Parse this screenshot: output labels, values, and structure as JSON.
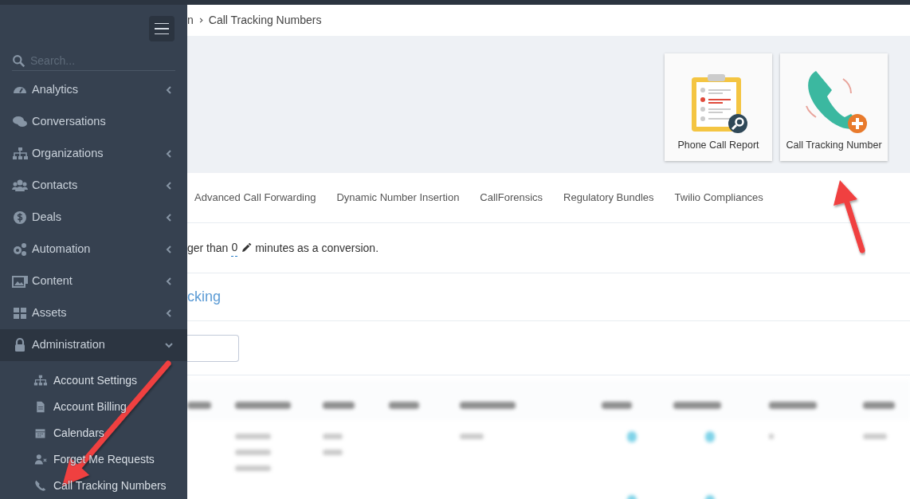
{
  "sidebar": {
    "search": {
      "placeholder": "Search..."
    },
    "items": [
      {
        "label": "Analytics",
        "kind": "group",
        "expanded": false,
        "selected": false
      },
      {
        "label": "Conversations",
        "kind": "link",
        "selected": false
      },
      {
        "label": "Organizations",
        "kind": "group",
        "expanded": false,
        "selected": false
      },
      {
        "label": "Contacts",
        "kind": "group",
        "expanded": false,
        "selected": false
      },
      {
        "label": "Deals",
        "kind": "group",
        "expanded": false,
        "selected": false
      },
      {
        "label": "Automation",
        "kind": "group",
        "expanded": false,
        "selected": false
      },
      {
        "label": "Content",
        "kind": "group",
        "expanded": false,
        "selected": false
      },
      {
        "label": "Assets",
        "kind": "group",
        "expanded": false,
        "selected": false
      },
      {
        "label": "Administration",
        "kind": "group",
        "expanded": true,
        "selected": true,
        "children": [
          {
            "label": "Account Settings"
          },
          {
            "label": "Account Billing"
          },
          {
            "label": "Calendars"
          },
          {
            "label": "Forget Me Requests"
          },
          {
            "label": "Call Tracking Numbers"
          }
        ]
      }
    ]
  },
  "breadcrumb": [
    "n",
    "Call Tracking Numbers"
  ],
  "tiles": [
    {
      "label": "Phone Call Report"
    },
    {
      "label": "Call Tracking Number"
    }
  ],
  "tabs": [
    {
      "label": "Advanced Call Forwarding",
      "selected": false
    },
    {
      "label": "Dynamic Number Insertion",
      "selected": false
    },
    {
      "label": "CallForensics",
      "selected": false
    },
    {
      "label": "Regulatory Bundles",
      "selected": false
    },
    {
      "label": "Twilio Compliances",
      "selected": false
    }
  ],
  "conversion_note": {
    "before": "ger than",
    "value": "0",
    "after": "minutes as a conversion."
  },
  "section_title": "cking"
}
